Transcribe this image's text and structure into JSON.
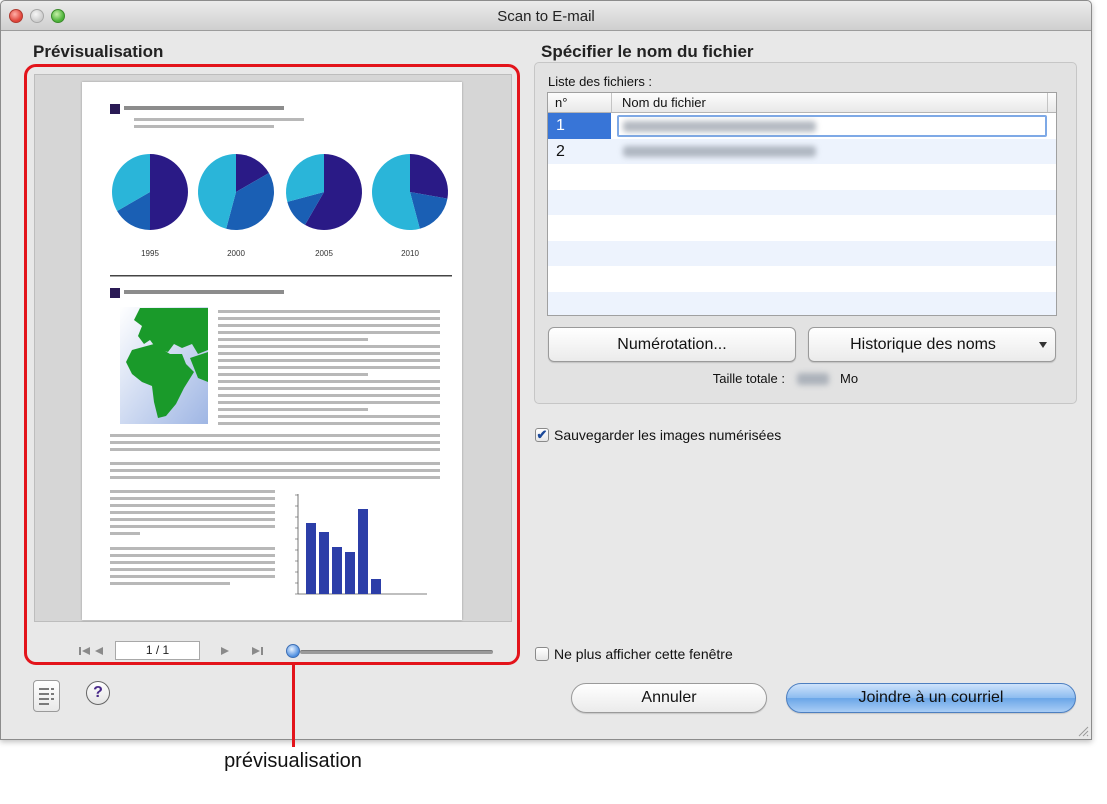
{
  "window": {
    "title": "Scan to E-mail"
  },
  "preview": {
    "heading": "Prévisualisation",
    "page_field": "1 / 1",
    "years": [
      "1995",
      "2000",
      "2005",
      "2010"
    ]
  },
  "right": {
    "heading": "Spécifier le nom du fichier",
    "list_label": "Liste des fichiers :",
    "columns": [
      "n°",
      "Nom du fichier"
    ],
    "rows": [
      {
        "n": "1"
      },
      {
        "n": "2"
      }
    ],
    "numbering_button": "Numérotation...",
    "history_button": "Historique des noms",
    "total_label": "Taille totale :",
    "total_unit": "Mo"
  },
  "options": {
    "save_images": {
      "label": "Sauvegarder les images numérisées",
      "checked": true
    },
    "dont_show": {
      "label": "Ne plus afficher cette fenêtre",
      "checked": false
    }
  },
  "footer": {
    "help_label": "?",
    "cancel": "Annuler",
    "attach": "Joindre à un courriel"
  },
  "callout": {
    "label": "prévisualisation"
  },
  "colors": {
    "callout": "#e3141b",
    "selection": "#3875d7",
    "pie_cyan": "#2ab5d9",
    "pie_navy": "#2a1a86",
    "pie_blue": "#1a5fb4",
    "map_green": "#1a9a2a"
  }
}
